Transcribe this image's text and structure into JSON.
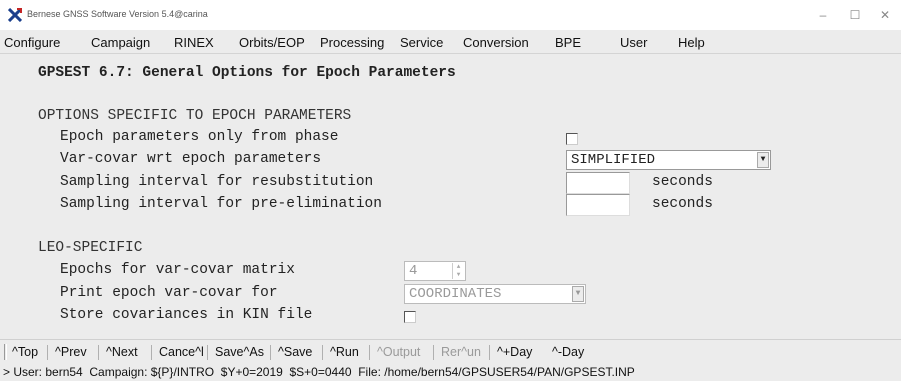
{
  "window": {
    "title": "Bernese GNSS Software Version 5.4@carina",
    "minimize": "–",
    "maximize": "☐",
    "close": "✕"
  },
  "menu": {
    "configure": "Configure",
    "campaign": "Campaign",
    "rinex": "RINEX",
    "orbits": "Orbits/EOP",
    "processing": "Processing",
    "service": "Service",
    "conversion": "Conversion",
    "bpe": "BPE",
    "user": "User",
    "help": "Help"
  },
  "panel": {
    "title": "GPSEST 6.7: General Options for Epoch Parameters",
    "section1": "OPTIONS SPECIFIC TO EPOCH PARAMETERS",
    "epoch_only_phase_label": "Epoch parameters only from phase",
    "epoch_only_phase_checked": false,
    "varcovar_label": "Var-covar wrt epoch parameters",
    "varcovar_value": "SIMPLIFIED",
    "resub_label": "Sampling interval for resubstitution",
    "resub_value": "",
    "resub_unit": "seconds",
    "preelim_label": "Sampling interval for pre-elimination",
    "preelim_value": "",
    "preelim_unit": "seconds",
    "section2": "LEO-SPECIFIC",
    "epochs_varcovar_label": "Epochs for var-covar matrix",
    "epochs_varcovar_value": "4",
    "print_varcovar_label": "Print epoch var-covar for",
    "print_varcovar_value": "COORDINATES",
    "store_cov_label": "Store covariances in KIN file",
    "store_cov_checked": false
  },
  "toolbar": {
    "top": "^Top",
    "prev": "^Prev",
    "next": "^Next",
    "cancel": "Cance^l",
    "saveas": "Save^As",
    "save": "^Save",
    "run": "^Run",
    "output": "^Output",
    "rerun": "Rer^un",
    "plusday": "^+Day",
    "minusday": "^-Day"
  },
  "status": {
    "text": "> User: bern54  Campaign: ${P}/INTRO  $Y+0=2019  $S+0=0440  File: /home/bern54/GPSUSER54/PAN/GPSEST.INP"
  },
  "colors": {
    "background": "#ececec",
    "disabled_text": "#9a9a9a"
  }
}
